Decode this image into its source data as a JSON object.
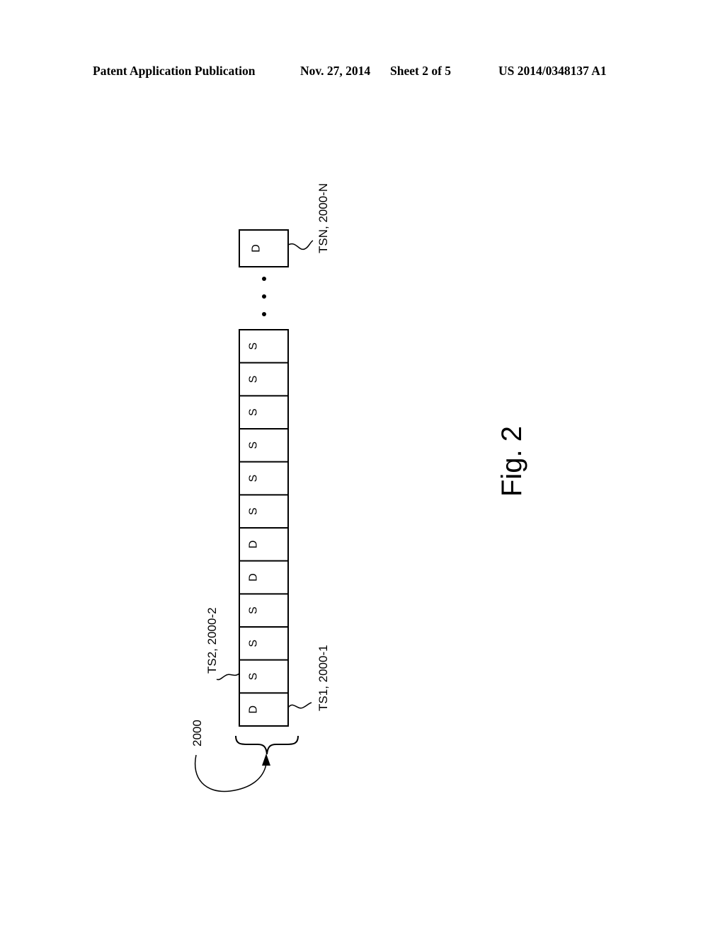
{
  "header": {
    "publication": "Patent Application Publication",
    "date": "Nov. 27, 2014",
    "sheet": "Sheet 2 of 5",
    "number": "US 2014/0348137 A1"
  },
  "figure": {
    "caption": "Fig. 2",
    "frame_label": "2000",
    "cells": [
      "D",
      "S",
      "S",
      "S",
      "D",
      "D",
      "S",
      "S",
      "S",
      "S",
      "S",
      "S"
    ],
    "last_cell": "D",
    "labels": {
      "ts1": "TS1, 2000-1",
      "ts2": "TS2, 2000-2",
      "tsn": "TSN, 2000-N"
    }
  }
}
